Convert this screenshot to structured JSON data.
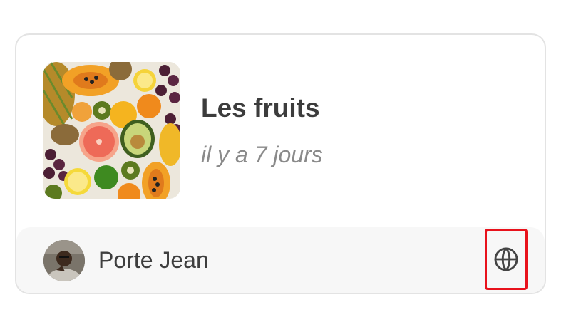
{
  "post": {
    "title": "Les fruits",
    "time_ago": "il y a 7 jours",
    "thumbnail_icon": "fruits-photo",
    "author": {
      "name": "Porte Jean",
      "avatar_icon": "user-avatar"
    },
    "visibility_icon": "globe-icon"
  },
  "colors": {
    "title": "#3c3c3c",
    "subtitle": "#8a8a8a",
    "footer_bg": "#f7f7f7",
    "highlight": "#e8121c"
  }
}
